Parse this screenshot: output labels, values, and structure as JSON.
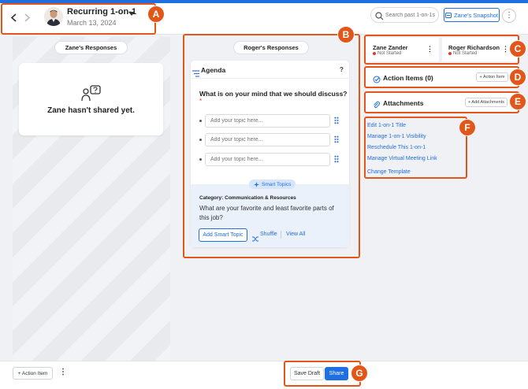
{
  "header": {
    "meeting_title": "Recurring 1-on-1",
    "meeting_date": "March 13, 2024",
    "search_placeholder": "Search past 1-on-1s",
    "snapshot_label": "Zane's Snapshot",
    "prev_icon": "chevron-left-icon",
    "next_icon": "chevron-right-icon"
  },
  "left": {
    "responses_label": "Zane's Responses",
    "empty_text": "Zane hasn't shared yet."
  },
  "middle": {
    "responses_label": "Roger's Responses",
    "agenda_title": "Agenda",
    "help_label": "?",
    "question": "What is on your mind that we should discuss?",
    "required_marker": "*",
    "topic_placeholders": [
      "Add your topic here...",
      "Add your topic here...",
      "Add your topic here..."
    ],
    "smart_topics_label": "Smart Topics",
    "category": "Category: Communication & Resources",
    "smart_question": "What are your favorite and least favorite parts of this job?",
    "add_smart_label": "Add Smart Topic",
    "shuffle_label": "Shuffle",
    "view_all_label": "View All"
  },
  "right": {
    "participants": [
      {
        "name": "Zane Zander",
        "status": "Not Started"
      },
      {
        "name": "Roger Richardson",
        "status": "Not Started"
      }
    ],
    "action_items_title": "Action Items (0)",
    "add_action_item_label": "+ Action Item",
    "attachments_title": "Attachments",
    "add_attachments_label": "+ Add Attachments",
    "menu_links": [
      "Edit 1-on-1 Title",
      "Manage 1-on-1 Visibility",
      "Reschedule This 1-on-1",
      "Manage Virtual Meeting Link",
      "Change Template"
    ]
  },
  "bottom": {
    "action_item_label": "+ Action Item",
    "save_draft_label": "Save Draft",
    "share_label": "Share"
  },
  "annotations": [
    "A",
    "B",
    "C",
    "D",
    "E",
    "F",
    "G"
  ],
  "colors": {
    "brand_blue": "#1f6fe0",
    "annotation_orange": "#e25719",
    "status_red": "#e03c31"
  }
}
